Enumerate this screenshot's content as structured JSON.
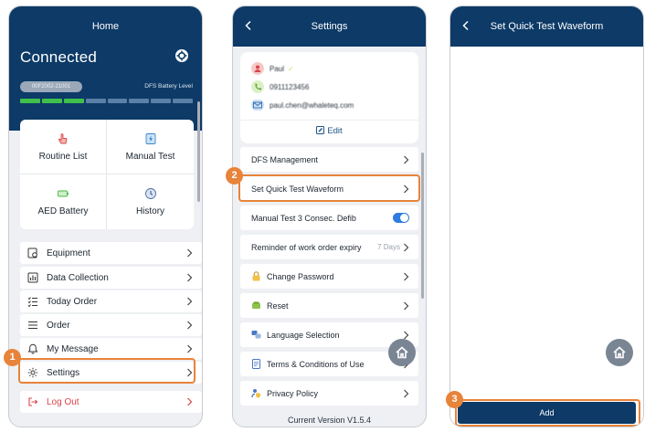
{
  "screen1": {
    "title": "Home",
    "status": "Connected",
    "serial": "00F2002-21001",
    "battery_label": "DFS Battery Level",
    "battery_segments_on": 3,
    "battery_segments_total": 8,
    "grid": [
      {
        "label": "Routine List",
        "icon": "hand-pointer-icon"
      },
      {
        "label": "Manual Test",
        "icon": "lightning-tablet-icon"
      },
      {
        "label": "AED Battery",
        "icon": "battery-icon"
      },
      {
        "label": "History",
        "icon": "clock-history-icon"
      }
    ],
    "menu": [
      {
        "label": "Equipment",
        "icon": "equipment-icon"
      },
      {
        "label": "Data Collection",
        "icon": "data-collection-icon"
      },
      {
        "label": "Today Order",
        "icon": "checklist-icon"
      },
      {
        "label": "Order",
        "icon": "order-list-icon"
      },
      {
        "label": "My Message",
        "icon": "bell-icon"
      },
      {
        "label": "Settings",
        "icon": "gear-icon"
      }
    ],
    "logout": "Log Out",
    "step_badge": "1",
    "accent": "#e8833a",
    "logout_color": "#d9434a"
  },
  "screen2": {
    "title": "Settings",
    "profile": {
      "name": "Paul",
      "phone": "0911123456",
      "email": "paul.chen@whaleteq.com",
      "edit_label": "Edit"
    },
    "items": [
      {
        "label": "DFS Management"
      },
      {
        "label": "Set Quick Test Waveform"
      },
      {
        "label": "Manual Test 3 Consec. Defib"
      },
      {
        "label": "Reminder of work order expiry",
        "value": "7 Days"
      },
      {
        "label": "Change Password",
        "icon": "lock-icon"
      },
      {
        "label": "Reset",
        "icon": "reset-icon"
      },
      {
        "label": "Language Selection",
        "icon": "language-icon"
      },
      {
        "label": "Terms & Conditions of Use",
        "icon": "document-icon"
      },
      {
        "label": "Privacy Policy",
        "icon": "person-shield-icon"
      }
    ],
    "version": "Current Version V1.5.4",
    "step_badge": "2"
  },
  "screen3": {
    "title": "Set Quick Test Waveform",
    "add_label": "Add",
    "step_badge": "3"
  },
  "colors": {
    "navy": "#0d3a67",
    "highlight": "#e8833a",
    "toggle_on": "#2f7ce0"
  }
}
